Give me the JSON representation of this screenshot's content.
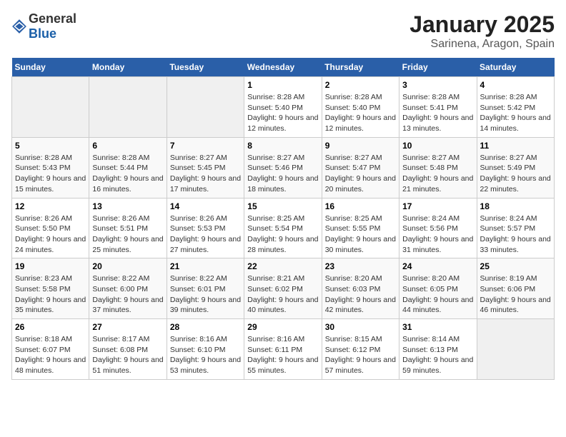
{
  "header": {
    "logo_general": "General",
    "logo_blue": "Blue",
    "title": "January 2025",
    "subtitle": "Sarinena, Aragon, Spain"
  },
  "weekdays": [
    "Sunday",
    "Monday",
    "Tuesday",
    "Wednesday",
    "Thursday",
    "Friday",
    "Saturday"
  ],
  "weeks": [
    [
      {
        "day": "",
        "info": ""
      },
      {
        "day": "",
        "info": ""
      },
      {
        "day": "",
        "info": ""
      },
      {
        "day": "1",
        "info": "Sunrise: 8:28 AM\nSunset: 5:40 PM\nDaylight: 9 hours and 12 minutes."
      },
      {
        "day": "2",
        "info": "Sunrise: 8:28 AM\nSunset: 5:40 PM\nDaylight: 9 hours and 12 minutes."
      },
      {
        "day": "3",
        "info": "Sunrise: 8:28 AM\nSunset: 5:41 PM\nDaylight: 9 hours and 13 minutes."
      },
      {
        "day": "4",
        "info": "Sunrise: 8:28 AM\nSunset: 5:42 PM\nDaylight: 9 hours and 14 minutes."
      }
    ],
    [
      {
        "day": "5",
        "info": "Sunrise: 8:28 AM\nSunset: 5:43 PM\nDaylight: 9 hours and 15 minutes."
      },
      {
        "day": "6",
        "info": "Sunrise: 8:28 AM\nSunset: 5:44 PM\nDaylight: 9 hours and 16 minutes."
      },
      {
        "day": "7",
        "info": "Sunrise: 8:27 AM\nSunset: 5:45 PM\nDaylight: 9 hours and 17 minutes."
      },
      {
        "day": "8",
        "info": "Sunrise: 8:27 AM\nSunset: 5:46 PM\nDaylight: 9 hours and 18 minutes."
      },
      {
        "day": "9",
        "info": "Sunrise: 8:27 AM\nSunset: 5:47 PM\nDaylight: 9 hours and 20 minutes."
      },
      {
        "day": "10",
        "info": "Sunrise: 8:27 AM\nSunset: 5:48 PM\nDaylight: 9 hours and 21 minutes."
      },
      {
        "day": "11",
        "info": "Sunrise: 8:27 AM\nSunset: 5:49 PM\nDaylight: 9 hours and 22 minutes."
      }
    ],
    [
      {
        "day": "12",
        "info": "Sunrise: 8:26 AM\nSunset: 5:50 PM\nDaylight: 9 hours and 24 minutes."
      },
      {
        "day": "13",
        "info": "Sunrise: 8:26 AM\nSunset: 5:51 PM\nDaylight: 9 hours and 25 minutes."
      },
      {
        "day": "14",
        "info": "Sunrise: 8:26 AM\nSunset: 5:53 PM\nDaylight: 9 hours and 27 minutes."
      },
      {
        "day": "15",
        "info": "Sunrise: 8:25 AM\nSunset: 5:54 PM\nDaylight: 9 hours and 28 minutes."
      },
      {
        "day": "16",
        "info": "Sunrise: 8:25 AM\nSunset: 5:55 PM\nDaylight: 9 hours and 30 minutes."
      },
      {
        "day": "17",
        "info": "Sunrise: 8:24 AM\nSunset: 5:56 PM\nDaylight: 9 hours and 31 minutes."
      },
      {
        "day": "18",
        "info": "Sunrise: 8:24 AM\nSunset: 5:57 PM\nDaylight: 9 hours and 33 minutes."
      }
    ],
    [
      {
        "day": "19",
        "info": "Sunrise: 8:23 AM\nSunset: 5:58 PM\nDaylight: 9 hours and 35 minutes."
      },
      {
        "day": "20",
        "info": "Sunrise: 8:22 AM\nSunset: 6:00 PM\nDaylight: 9 hours and 37 minutes."
      },
      {
        "day": "21",
        "info": "Sunrise: 8:22 AM\nSunset: 6:01 PM\nDaylight: 9 hours and 39 minutes."
      },
      {
        "day": "22",
        "info": "Sunrise: 8:21 AM\nSunset: 6:02 PM\nDaylight: 9 hours and 40 minutes."
      },
      {
        "day": "23",
        "info": "Sunrise: 8:20 AM\nSunset: 6:03 PM\nDaylight: 9 hours and 42 minutes."
      },
      {
        "day": "24",
        "info": "Sunrise: 8:20 AM\nSunset: 6:05 PM\nDaylight: 9 hours and 44 minutes."
      },
      {
        "day": "25",
        "info": "Sunrise: 8:19 AM\nSunset: 6:06 PM\nDaylight: 9 hours and 46 minutes."
      }
    ],
    [
      {
        "day": "26",
        "info": "Sunrise: 8:18 AM\nSunset: 6:07 PM\nDaylight: 9 hours and 48 minutes."
      },
      {
        "day": "27",
        "info": "Sunrise: 8:17 AM\nSunset: 6:08 PM\nDaylight: 9 hours and 51 minutes."
      },
      {
        "day": "28",
        "info": "Sunrise: 8:16 AM\nSunset: 6:10 PM\nDaylight: 9 hours and 53 minutes."
      },
      {
        "day": "29",
        "info": "Sunrise: 8:16 AM\nSunset: 6:11 PM\nDaylight: 9 hours and 55 minutes."
      },
      {
        "day": "30",
        "info": "Sunrise: 8:15 AM\nSunset: 6:12 PM\nDaylight: 9 hours and 57 minutes."
      },
      {
        "day": "31",
        "info": "Sunrise: 8:14 AM\nSunset: 6:13 PM\nDaylight: 9 hours and 59 minutes."
      },
      {
        "day": "",
        "info": ""
      }
    ]
  ]
}
